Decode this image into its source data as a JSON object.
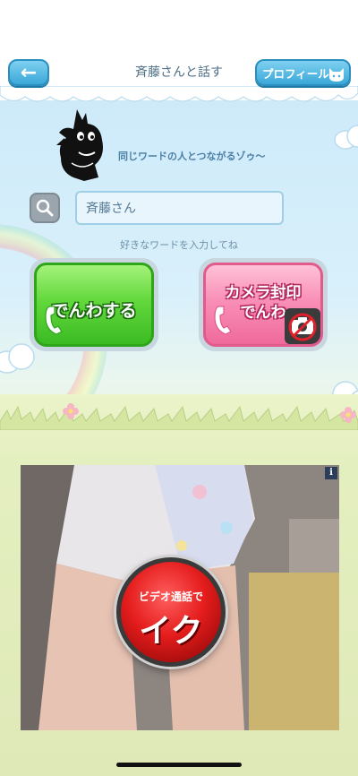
{
  "header": {
    "back_arrow": "←",
    "title": "斉藤さんと話す",
    "profile_label": "プロフィール"
  },
  "main": {
    "tagline": "同じワードの人とつながるゾゥ～",
    "search_value": "斉藤さん",
    "hint": "好きなワードを入力してね",
    "call_button_label": "でんわする",
    "camera_call_line1": "カメラ封印",
    "camera_call_line2": "でんわ"
  },
  "ad": {
    "info": "i",
    "cta_small": "ビデオ通話で",
    "cta_big": "イク"
  },
  "colors": {
    "header_button": "#3aa8d8",
    "call_green": "#4fcb2e",
    "call_pink": "#f47aa8",
    "cta_red": "#e51d1d"
  }
}
